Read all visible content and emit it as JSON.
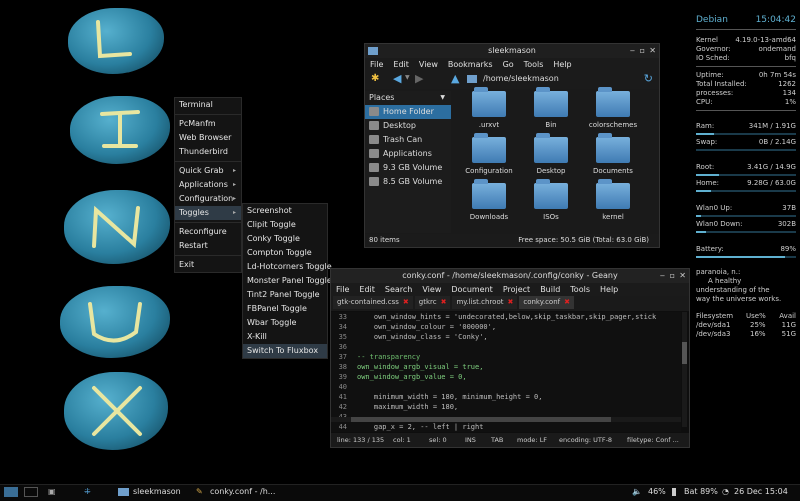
{
  "desktop_menu": {
    "items": [
      {
        "label": "Terminal",
        "arrow": ""
      },
      {
        "sep": true
      },
      {
        "label": "PcManfm",
        "arrow": ""
      },
      {
        "label": "Web Browser",
        "arrow": ""
      },
      {
        "label": "Thunderbird",
        "arrow": ""
      },
      {
        "sep": true
      },
      {
        "label": "Quick Grab",
        "arrow": "▸"
      },
      {
        "label": "Applications",
        "arrow": "▸"
      },
      {
        "label": "Configuration",
        "arrow": "▸"
      },
      {
        "label": "Toggles",
        "arrow": "▸"
      },
      {
        "sep": true
      },
      {
        "label": "Reconfigure",
        "arrow": ""
      },
      {
        "label": "Restart",
        "arrow": ""
      },
      {
        "sep": true
      },
      {
        "label": "Exit",
        "arrow": ""
      }
    ],
    "selected": "Toggles"
  },
  "toggles_menu": {
    "items": [
      "Screenshot",
      "Clipit Toggle",
      "Conky Toggle",
      "Compton Toggle",
      "Ld-Hotcorners Toggle",
      "Monster Panel Toggle",
      "Tint2 Panel Toggle",
      "FBPanel Toggle",
      "Wbar Toggle",
      "X-Kill",
      "Switch To Fluxbox"
    ],
    "selected": "Switch To Fluxbox"
  },
  "file_manager": {
    "title": "sleekmason",
    "menu": [
      "File",
      "Edit",
      "View",
      "Bookmarks",
      "Go",
      "Tools",
      "Help"
    ],
    "path": "/home/sleekmason",
    "places_label": "Places",
    "places": [
      "Home Folder",
      "Desktop",
      "Trash Can",
      "Applications",
      "9.3 GB Volume",
      "8.5 GB Volume"
    ],
    "selected_place": "Home Folder",
    "folders": [
      ".urxvt",
      "Bin",
      "colorschemes",
      "Configuration",
      "Desktop",
      "Documents",
      "Downloads",
      "ISOs",
      "kernel"
    ],
    "status_left": "80 items",
    "status_right": "Free space: 50.5 GiB (Total: 63.0 GiB)"
  },
  "editor": {
    "title": "conky.conf - /home/sleekmason/.config/conky - Geany",
    "menu": [
      "File",
      "Edit",
      "Search",
      "View",
      "Document",
      "Project",
      "Build",
      "Tools",
      "Help"
    ],
    "tabs": [
      "gtk-contained.css",
      "gtkrc",
      "my.list.chroot",
      "conky.conf"
    ],
    "active_tab": "conky.conf",
    "lines": [
      {
        "n": "33",
        "t": "    own_window_hints = 'undecorated,below,skip_taskbar,skip_pager,stick"
      },
      {
        "n": "34",
        "t": "    own_window_colour = '000000',"
      },
      {
        "n": "35",
        "t": "    own_window_class = 'Conky',"
      },
      {
        "n": "36",
        "t": ""
      },
      {
        "n": "37",
        "t": "-- transparency"
      },
      {
        "n": "38",
        "t": "own_window_argb_visual = true,"
      },
      {
        "n": "39",
        "t": "own_window_argb_value = 0,"
      },
      {
        "n": "40",
        "t": ""
      },
      {
        "n": "41",
        "t": "    minimum_width = 180, minimum_height = 0,"
      },
      {
        "n": "42",
        "t": "    maximum_width = 180,"
      },
      {
        "n": "43",
        "t": ""
      },
      {
        "n": "44",
        "t": "    gap_x = 2, -- left | right"
      }
    ],
    "status": {
      "line": "line: 133 / 135",
      "col": "col: 1",
      "sel": "sel: 0",
      "ins": "INS",
      "tab": "TAB",
      "mode": "mode: LF",
      "encoding": "encoding: UTF-8",
      "filetype": "filetype: Conf ..."
    }
  },
  "conky": {
    "distro": "Debian",
    "time": "15:04:42",
    "kernel_l": "Kernel",
    "kernel_r": "4.19.0-13-amd64",
    "governor_l": "Governor:",
    "governor_r": "ondemand",
    "iosched_l": "IO Sched:",
    "iosched_r": "bfq",
    "uptime_l": "Uptime:",
    "uptime_r": "0h 7m 54s",
    "installed_l": "Total Installed:",
    "installed_r": "1262",
    "processes_l": "processes:",
    "processes_r": "134",
    "cpu_l": "CPU:",
    "cpu_r": "1%",
    "ram_l": "Ram:",
    "ram_r": "341M  / 1.91G",
    "ram_frac": 0.18,
    "swap_l": "Swap:",
    "swap_r": "0B  / 2.14G",
    "swap_frac": 0.0,
    "root_l": "Root:",
    "root_r": "3.41G / 14.9G",
    "root_frac": 0.23,
    "home_l": "Home:",
    "home_r": "9.28G / 63.0G",
    "home_frac": 0.15,
    "wup_l": "Wlan0 Up:",
    "wup_r": "37B",
    "wup_frac": 0.05,
    "wdown_l": "Wlan0 Down:",
    "wdown_r": "302B",
    "wdown_frac": 0.1,
    "battery_l": "Battery:",
    "battery_r": "89%",
    "battery_frac": 0.89,
    "quote1": "paranoia, n.:",
    "quote2": "A healthy",
    "quote3": "understanding of the",
    "quote4": "way the universe works.",
    "fs_h1": "Filesystem",
    "fs_h2": "Use%",
    "fs_h3": "Avail",
    "fs1_n": "/dev/sda1",
    "fs1_u": "25%",
    "fs1_a": "11G",
    "fs2_n": "/dev/sda3",
    "fs2_u": "16%",
    "fs2_a": "51G"
  },
  "taskbar": {
    "task1": "sleekmason",
    "task2": "conky.conf - /h...",
    "volume": "46%",
    "battery": "Bat 89%",
    "clock": "26 Dec 15:04"
  },
  "colors": {
    "accent": "#2c6ea0",
    "conky_bar": "#5fb0d0",
    "close_red": "#e02020"
  }
}
